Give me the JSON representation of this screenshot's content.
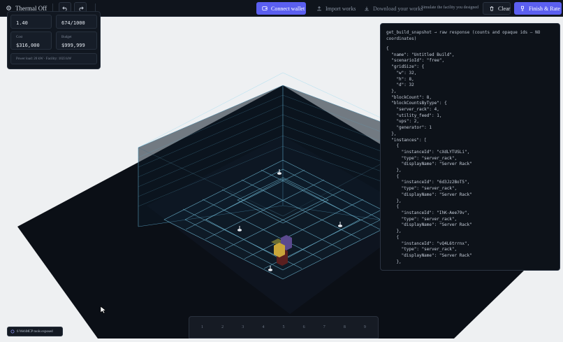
{
  "topbar": {
    "brand_label": "Thermal Off",
    "connect_label": "Connect wallet",
    "import_label": "Import works",
    "download_label": "Download your works",
    "simulate_hint": "Simulate the facility you designed",
    "clear_label": "Clear",
    "finish_label": "Finish & Rate"
  },
  "stats": {
    "pue_value": "1.40",
    "capacity_value": "674/1000",
    "cost_label": "Cost",
    "cost_value": "$316,000",
    "budget_label": "Budget",
    "budget_value": "$999,999",
    "footer": "Power load: 20 kW · Facility: 1023 kW"
  },
  "response": {
    "title": "get_build_snapshot → raw response (counts and opaque ids — NO coordinates)",
    "body": "{\n  \"name\": \"Untitled Build\",\n  \"scenarioId\": \"free\",\n  \"gridSize\": {\n    \"w\": 32,\n    \"h\": 8,\n    \"d\": 32\n  },\n  \"blockCount\": 8,\n  \"blockCountsByType\": {\n    \"server_rack\": 4,\n    \"utility_feed\": 1,\n    \"ups\": 2,\n    \"generator\": 1\n  },\n  \"instances\": [\n    {\n      \"instanceId\": \"cXdLYTUSLi\",\n      \"type\": \"server_rack\",\n      \"displayName\": \"Server Rack\"\n    },\n    {\n      \"instanceId\": \"6d3Jz2BoT5\",\n      \"type\": \"server_rack\",\n      \"displayName\": \"Server Rack\"\n    },\n    {\n      \"instanceId\": \"IhK-Aee79v\",\n      \"type\": \"server_rack\",\n      \"displayName\": \"Server Rack\"\n    },\n    {\n      \"instanceId\": \"vQ4L6trrnx\",\n      \"type\": \"server_rack\",\n      \"displayName\": \"Server Rack\"\n    },"
  },
  "slots": [
    "1",
    "2",
    "3",
    "4",
    "5",
    "6",
    "7",
    "8",
    "9"
  ],
  "mcp_badge": "6 WebMCP tools exposed",
  "colors": {
    "accent": "#5b5ff0",
    "panel": "#111720",
    "floor": "#0b0f16",
    "grid": "#7fd3f0"
  }
}
